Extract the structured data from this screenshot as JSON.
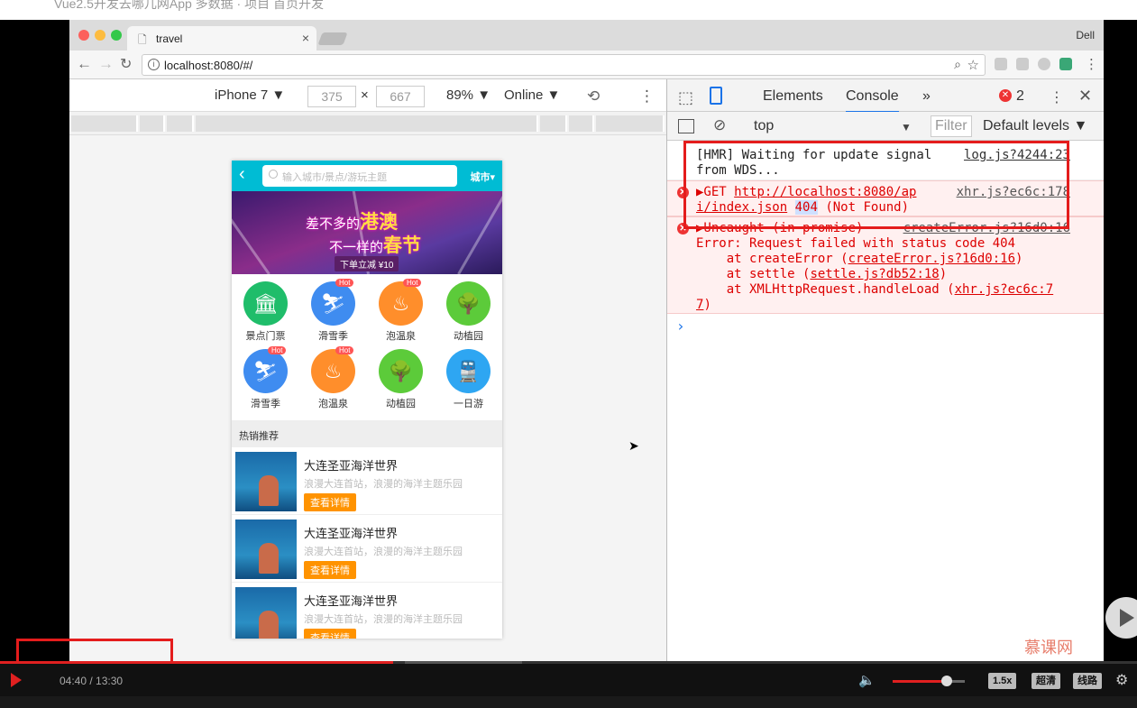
{
  "outer": {
    "title_fragment": "Vue2.5开发去哪儿网App 多数据 · 项目 首页开发"
  },
  "browser": {
    "tab_title": "travel",
    "profile": "Dell",
    "url": "localhost:8080/#/"
  },
  "device_toolbar": {
    "device": "iPhone 7 ▼",
    "width": "375",
    "times": "×",
    "height": "667",
    "zoom": "89% ▼",
    "network": "Online ▼"
  },
  "phone": {
    "back": "‹",
    "search_placeholder": "输入城市/景点/游玩主题",
    "city": "城市▾",
    "banner_line1_pre": "差不多的",
    "banner_line1_big": "港澳",
    "banner_line2_pre": "不一样的",
    "banner_line2_big": "春节",
    "banner_badge": "下单立减 ¥10",
    "icons": [
      {
        "label": "景点门票",
        "color": "#1fbd6a",
        "glyph": "🏛",
        "hot": ""
      },
      {
        "label": "滑雪季",
        "color": "#3f8cf0",
        "glyph": "⛷",
        "hot": "Hot"
      },
      {
        "label": "泡温泉",
        "color": "#ff8e2b",
        "glyph": "♨",
        "hot": "Hot"
      },
      {
        "label": "动植园",
        "color": "#5ccb3a",
        "glyph": "🌳",
        "hot": ""
      },
      {
        "label": "滑雪季",
        "color": "#3f8cf0",
        "glyph": "⛷",
        "hot": "Hot"
      },
      {
        "label": "泡温泉",
        "color": "#ff8e2b",
        "glyph": "♨",
        "hot": "Hot"
      },
      {
        "label": "动植园",
        "color": "#5ccb3a",
        "glyph": "🌳",
        "hot": ""
      },
      {
        "label": "一日游",
        "color": "#2ea6f2",
        "glyph": "🚆",
        "hot": ""
      }
    ],
    "hot_title": "热销推荐",
    "items": [
      {
        "name": "大连圣亚海洋世界",
        "desc": "浪漫大连首站，浪漫的海洋主题乐园",
        "btn": "查看详情"
      },
      {
        "name": "大连圣亚海洋世界",
        "desc": "浪漫大连首站，浪漫的海洋主题乐园",
        "btn": "查看详情"
      },
      {
        "name": "大连圣亚海洋世界",
        "desc": "浪漫大连首站，浪漫的海洋主题乐园",
        "btn": "查看详情"
      }
    ]
  },
  "devtools": {
    "tab_elements": "Elements",
    "tab_console": "Console",
    "more": "»",
    "error_count": "2",
    "context": "top",
    "filter_placeholder": "Filter",
    "levels": "Default levels ▼",
    "prompt": "›",
    "console": {
      "hmr_line1": "[HMR] Waiting for update signal",
      "hmr_line2": "from WDS...",
      "hmr_src": "log.js?4244:23",
      "get_prefix": "▶GET ",
      "get_url1": "http://localhost:8080/ap",
      "get_url2": "i/index.json",
      "get_404": "404",
      "get_rest": " (Not Found)",
      "get_src": "xhr.js?ec6c:178",
      "unc_line": "▶Uncaught (in promise)",
      "unc_src": "createError.js?16d0:16",
      "err_line": "Error: Request failed with status code 404",
      "at1_pre": "    at createError (",
      "at1_src": "createError.js?16d0:16",
      "at2_pre": "    at settle (",
      "at2_src": "settle.js?db52:18",
      "at3_pre": "    at XMLHttpRequest.handleLoad (",
      "at3_src": "xhr.js?ec6c:7",
      "at3_tail": "7",
      "close_paren": ")"
    }
  },
  "player": {
    "time": "04:40 / 13:30",
    "speed": "1.5x",
    "quality": "超清",
    "route": "线路",
    "watermark": "慕课网",
    "progress_fraction": 0.3457
  }
}
